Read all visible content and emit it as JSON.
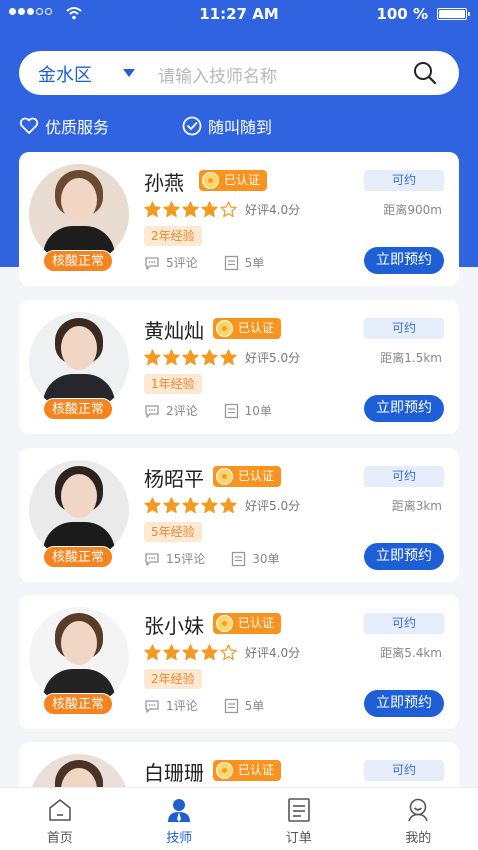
{
  "status_bar": {
    "time": "11:27 AM",
    "battery": "100 %"
  },
  "search": {
    "region": "金水区",
    "placeholder": "请输入技师名称"
  },
  "features": [
    "优质服务",
    "随叫随到"
  ],
  "technicians": [
    {
      "name": "孙燕",
      "verified": "已认证",
      "stars": 4,
      "rating": "好评4.0分",
      "experience": "2年经验",
      "comments": "5评论",
      "orders": "5单",
      "status": "可约",
      "distance": "距离900m",
      "nucleic": "核酸正常",
      "book": "立即预约"
    },
    {
      "name": "黄灿灿",
      "verified": "已认证",
      "stars": 5,
      "rating": "好评5.0分",
      "experience": "1年经验",
      "comments": "2评论",
      "orders": "10单",
      "status": "可约",
      "distance": "距离1.5km",
      "nucleic": "核酸正常",
      "book": "立即预约"
    },
    {
      "name": "杨昭平",
      "verified": "已认证",
      "stars": 5,
      "rating": "好评5.0分",
      "experience": "5年经验",
      "comments": "15评论",
      "orders": "30单",
      "status": "可约",
      "distance": "距离3km",
      "nucleic": "核酸正常",
      "book": "立即预约"
    },
    {
      "name": "张小妹",
      "verified": "已认证",
      "stars": 4,
      "rating": "好评4.0分",
      "experience": "2年经验",
      "comments": "1评论",
      "orders": "5单",
      "status": "可约",
      "distance": "距离5.4km",
      "nucleic": "核酸正常",
      "book": "立即预约"
    },
    {
      "name": "白珊珊",
      "verified": "已认证",
      "status": "可约"
    }
  ],
  "tabs": [
    "首页",
    "技师",
    "订单",
    "我的"
  ],
  "colors": {
    "primary": "#1f5fd6",
    "hero": "#2f63e0",
    "accent": "#f5841e",
    "star": "#f39a21"
  }
}
